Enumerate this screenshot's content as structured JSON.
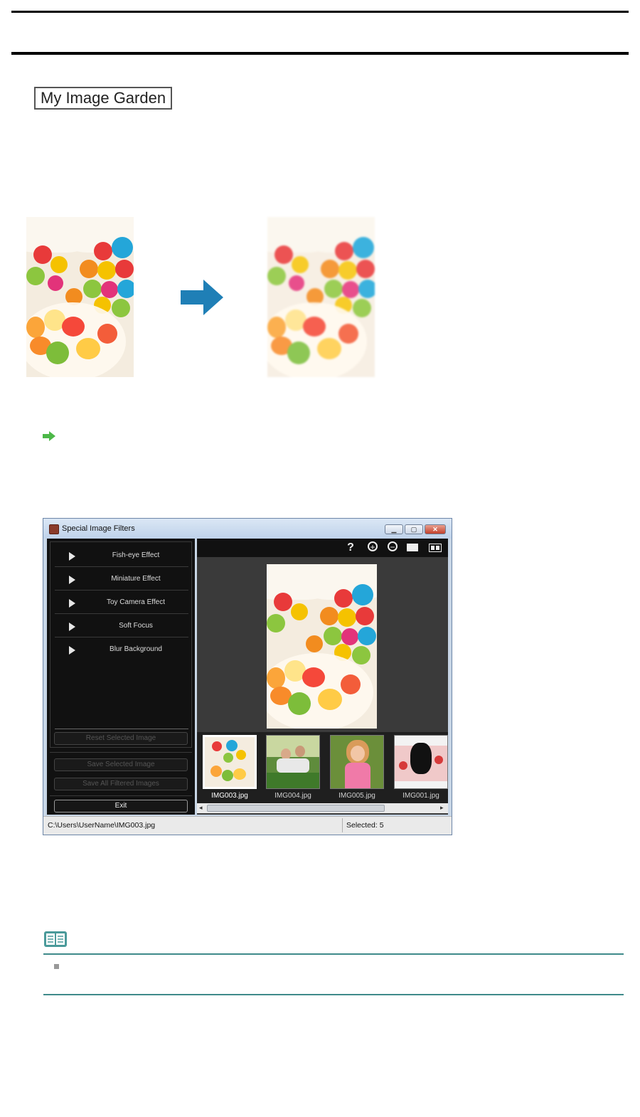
{
  "badge": {
    "label": "My Image Garden"
  },
  "window": {
    "title": "Special Image Filters",
    "effects": [
      {
        "label": "Fish-eye Effect"
      },
      {
        "label": "Miniature Effect"
      },
      {
        "label": "Toy Camera Effect"
      },
      {
        "label": "Soft Focus"
      },
      {
        "label": "Blur Background"
      }
    ],
    "buttons": {
      "reset": "Reset Selected Image",
      "save_selected": "Save Selected Image",
      "save_all": "Save All Filtered Images",
      "exit": "Exit"
    },
    "toolbar": {
      "help": "?"
    },
    "thumbnails": [
      {
        "name": "IMG003.jpg",
        "selected": true
      },
      {
        "name": "IMG004.jpg",
        "selected": false
      },
      {
        "name": "IMG005.jpg",
        "selected": false
      },
      {
        "name": "IMG001.jpg",
        "selected": false
      }
    ],
    "status": {
      "path": "C:\\Users\\UserName\\IMG003.jpg",
      "selected": "Selected: 5"
    }
  },
  "colors": {
    "arrow_blue": "#1f7fb6",
    "link_arrow_green": "#4cb848",
    "note_rule": "#3f8a8a"
  }
}
